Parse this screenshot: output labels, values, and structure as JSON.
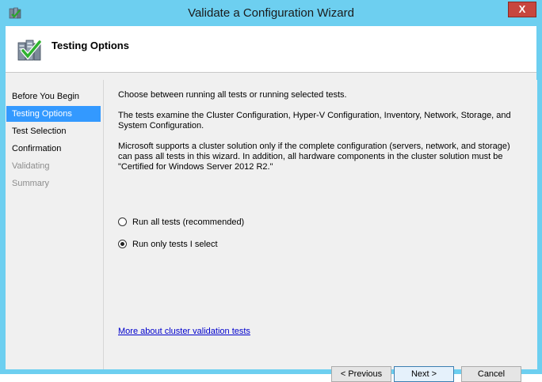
{
  "window": {
    "title": "Validate a Configuration Wizard",
    "close_glyph": "X"
  },
  "header": {
    "title": "Testing Options",
    "icon": "cluster-validate-checkmark-icon"
  },
  "nav": {
    "items": [
      {
        "label": "Before You Begin",
        "state": "normal"
      },
      {
        "label": "Testing Options",
        "state": "selected"
      },
      {
        "label": "Test Selection",
        "state": "normal"
      },
      {
        "label": "Confirmation",
        "state": "normal"
      },
      {
        "label": "Validating",
        "state": "disabled"
      },
      {
        "label": "Summary",
        "state": "disabled"
      }
    ]
  },
  "content": {
    "intro": "Choose between running all tests or running selected tests.",
    "tests_desc": "The tests examine the Cluster Configuration, Hyper-V Configuration, Inventory, Network, Storage, and System Configuration.",
    "support_note": "Microsoft supports a cluster solution only if the complete configuration (servers, network, and storage) can pass all tests in this wizard. In addition, all hardware components in the cluster solution must be \"Certified for Windows Server 2012 R2.\"",
    "options": [
      {
        "label": "Run all tests (recommended)",
        "selected": false
      },
      {
        "label": "Run only tests I select",
        "selected": true
      }
    ],
    "link": "More about cluster validation tests"
  },
  "buttons": {
    "previous": "< Previous",
    "next": "Next >",
    "cancel": "Cancel"
  },
  "colors": {
    "titlebar": "#6dcff0",
    "selection": "#3399ff",
    "close": "#c7463e",
    "link": "#0000cc"
  }
}
